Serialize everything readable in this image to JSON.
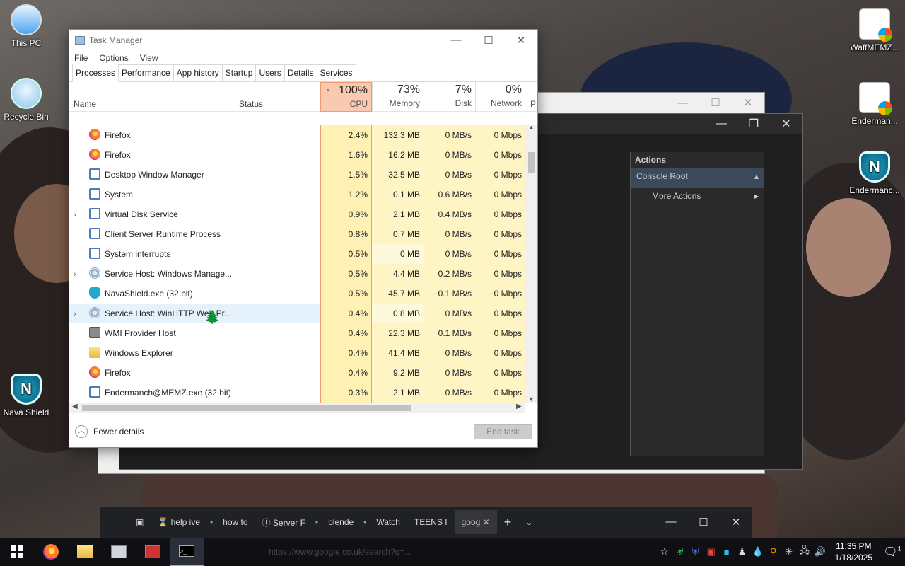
{
  "desktop": {
    "icons_left": [
      {
        "label": "This PC"
      },
      {
        "label": "Recycle Bin"
      },
      {
        "label": "Nava Shield"
      }
    ],
    "icons_right": [
      {
        "label": "WaffMEMZ..."
      },
      {
        "label": "Enderman..."
      },
      {
        "label": "Endermanc..."
      }
    ]
  },
  "mmc": {
    "actions_header": "Actions",
    "actions": [
      "Console Root",
      "More Actions"
    ]
  },
  "taskmanager": {
    "title": "Task Manager",
    "menu": [
      "File",
      "Options",
      "View"
    ],
    "tabs": [
      "Processes",
      "Performance",
      "App history",
      "Startup",
      "Users",
      "Details",
      "Services"
    ],
    "columns": {
      "name": "Name",
      "status": "Status",
      "cpu_pct": "100%",
      "cpu": "CPU",
      "mem_pct": "73%",
      "mem": "Memory",
      "disk_pct": "7%",
      "disk": "Disk",
      "net_pct": "0%",
      "net": "Network",
      "extra": "P"
    },
    "processes": [
      {
        "name": "Firefox",
        "icon": "firefox-icon",
        "expand": false,
        "cpu": "2.4%",
        "mem": "132.3 MB",
        "disk": "0 MB/s",
        "net": "0 Mbps"
      },
      {
        "name": "Firefox",
        "icon": "firefox-icon",
        "expand": false,
        "cpu": "1.6%",
        "mem": "16.2 MB",
        "disk": "0 MB/s",
        "net": "0 Mbps"
      },
      {
        "name": "Desktop Window Manager",
        "icon": "window-icon",
        "expand": false,
        "cpu": "1.5%",
        "mem": "32.5 MB",
        "disk": "0 MB/s",
        "net": "0 Mbps"
      },
      {
        "name": "System",
        "icon": "window-icon",
        "expand": false,
        "cpu": "1.2%",
        "mem": "0.1 MB",
        "disk": "0.6 MB/s",
        "net": "0 Mbps"
      },
      {
        "name": "Virtual Disk Service",
        "icon": "window-icon",
        "expand": true,
        "cpu": "0.9%",
        "mem": "2.1 MB",
        "disk": "0.4 MB/s",
        "net": "0 Mbps"
      },
      {
        "name": "Client Server Runtime Process",
        "icon": "window-icon",
        "expand": false,
        "cpu": "0.8%",
        "mem": "0.7 MB",
        "disk": "0 MB/s",
        "net": "0 Mbps"
      },
      {
        "name": "System interrupts",
        "icon": "window-icon",
        "expand": false,
        "cpu": "0.5%",
        "mem": "0 MB",
        "disk": "0 MB/s",
        "net": "0 Mbps"
      },
      {
        "name": "Service Host: Windows Manage...",
        "icon": "gear-icon",
        "expand": true,
        "cpu": "0.5%",
        "mem": "4.4 MB",
        "disk": "0.2 MB/s",
        "net": "0 Mbps"
      },
      {
        "name": "NavaShield.exe (32 bit)",
        "icon": "shield-icon",
        "expand": false,
        "cpu": "0.5%",
        "mem": "45.7 MB",
        "disk": "0.1 MB/s",
        "net": "0 Mbps"
      },
      {
        "name": "Service Host: WinHTTP Web Pr...",
        "icon": "gear-icon",
        "expand": true,
        "selected": true,
        "cpu": "0.4%",
        "mem": "0.8 MB",
        "disk": "0 MB/s",
        "net": "0 Mbps"
      },
      {
        "name": "WMI Provider Host",
        "icon": "wmi-icon",
        "expand": false,
        "cpu": "0.4%",
        "mem": "22.3 MB",
        "disk": "0.1 MB/s",
        "net": "0 Mbps"
      },
      {
        "name": "Windows Explorer",
        "icon": "folder-icon",
        "expand": false,
        "cpu": "0.4%",
        "mem": "41.4 MB",
        "disk": "0 MB/s",
        "net": "0 Mbps"
      },
      {
        "name": "Firefox",
        "icon": "firefox-icon",
        "expand": false,
        "cpu": "0.4%",
        "mem": "9.2 MB",
        "disk": "0 MB/s",
        "net": "0 Mbps"
      },
      {
        "name": "Endermanch@MEMZ.exe (32 bit)",
        "icon": "window-icon",
        "expand": false,
        "cpu": "0.3%",
        "mem": "2.1 MB",
        "disk": "0 MB/s",
        "net": "0 Mbps"
      }
    ],
    "fewer_details": "Fewer details",
    "end_task": "End task"
  },
  "browser_tabs": [
    "help ive",
    "how to",
    "Server F",
    "blende",
    "Watch",
    "TEENS I",
    "goog"
  ],
  "taskbar": {
    "address": "https://www.google.co.uk/search?q=...",
    "time": "11:35 PM",
    "date": "1/18/2025",
    "notifications": "1"
  },
  "colors": {
    "cpu_highlight": "#f9c9b0",
    "cell_heat": "#fff4c4",
    "selection": "#e5f1fb"
  }
}
